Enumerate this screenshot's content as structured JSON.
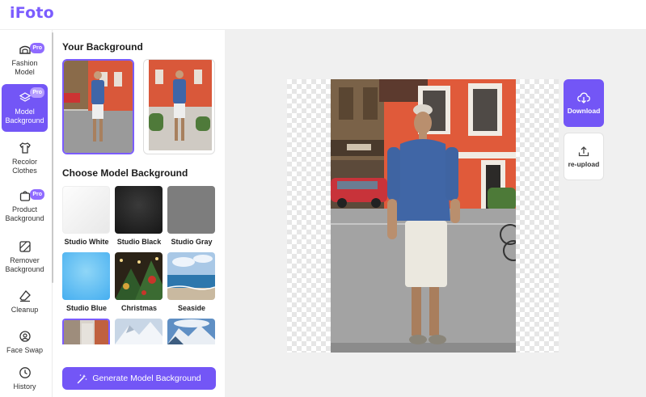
{
  "app": {
    "logo": "iFoto"
  },
  "sidebar": {
    "items": [
      {
        "label": "Fashion Model",
        "icon": "hanger-icon",
        "pro": "Pro"
      },
      {
        "label": "Model Background",
        "icon": "layers-icon",
        "pro": "Pro",
        "active": true
      },
      {
        "label": "Recolor Clothes",
        "icon": "tshirt-icon"
      },
      {
        "label": "Product Background",
        "icon": "bag-icon",
        "pro": "Pro"
      },
      {
        "label": "Remover Background",
        "icon": "remove-bg-icon"
      },
      {
        "label": "Cleanup",
        "icon": "eraser-icon"
      },
      {
        "label": "Face Swap",
        "icon": "face-swap-icon"
      },
      {
        "label": "History",
        "icon": "clock-icon"
      }
    ]
  },
  "panel": {
    "your_background_title": "Your Background",
    "choose_title": "Choose Model Background",
    "backgrounds": [
      {
        "label": "Studio White"
      },
      {
        "label": "Studio Black"
      },
      {
        "label": "Studio Gray"
      },
      {
        "label": "Studio Blue"
      },
      {
        "label": "Christmas"
      },
      {
        "label": "Seaside"
      }
    ],
    "generate_label": "Generate Model Background"
  },
  "actions": {
    "download_label": "Download",
    "reupload_label": "re-upload"
  },
  "colors": {
    "accent": "#7356f6",
    "logo": "#7b5cff"
  }
}
